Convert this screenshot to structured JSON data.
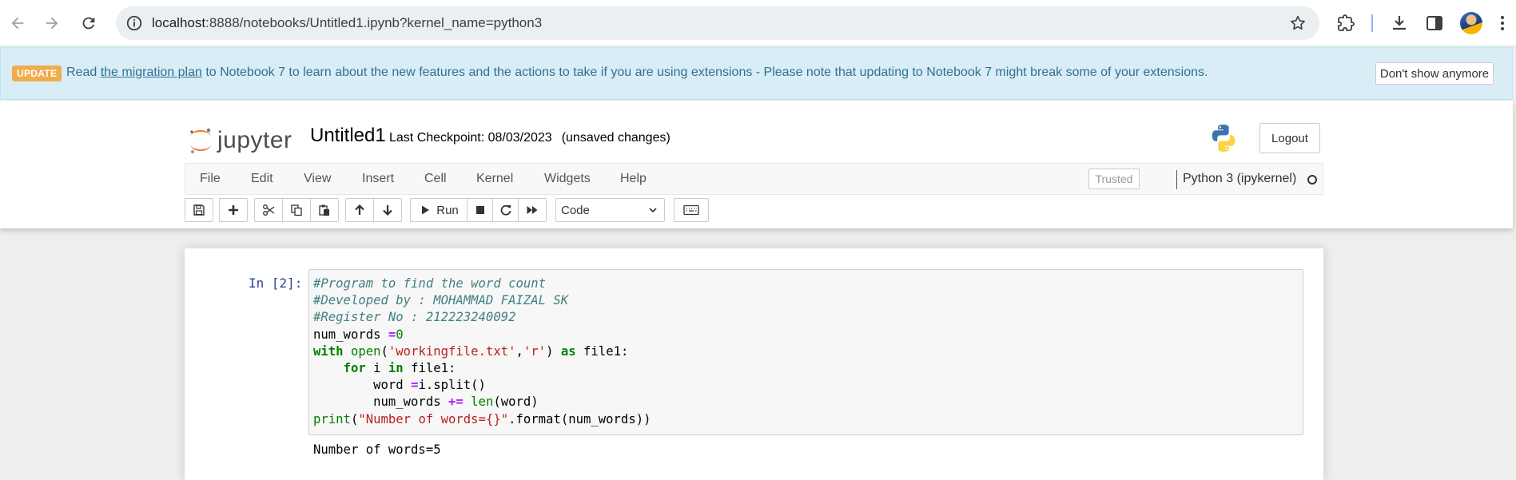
{
  "browser": {
    "url_host": "localhost",
    "url_rest": ":8888/notebooks/Untitled1.ipynb?kernel_name=python3"
  },
  "banner": {
    "badge": "UPDATE",
    "text_before": "Read ",
    "link": "the migration plan",
    "text_after": " to Notebook 7 to learn about the new features and the actions to take if you are using extensions - Please note that updating to Notebook 7 might break some of your extensions.",
    "dismiss": "Don't show anymore"
  },
  "header": {
    "logo_text": "jupyter",
    "notebook_name": "Untitled1",
    "checkpoint": "Last Checkpoint: 08/03/2023",
    "unsaved": "(unsaved changes)",
    "logout": "Logout"
  },
  "menu": {
    "items": [
      "File",
      "Edit",
      "View",
      "Insert",
      "Cell",
      "Kernel",
      "Widgets",
      "Help"
    ],
    "trusted": "Trusted",
    "kernel": "Python 3 (ipykernel)"
  },
  "toolbar": {
    "run_label": "Run",
    "cell_type": "Code"
  },
  "cell": {
    "prompt": "In [2]:",
    "code_lines": [
      "#Program to find the word count",
      "#Developed by : MOHAMMAD FAIZAL SK",
      "#Register No : 212223240092",
      "num_words =0",
      "with open('workingfile.txt','r') as file1:",
      "    for i in file1:",
      "        word =i.split()",
      "        num_words += len(word)",
      "print(\"Number of words={}\".format(num_words))"
    ],
    "output": "Number of words=5"
  },
  "colors": {
    "banner_bg": "#d9edf7",
    "banner_text": "#31708f",
    "badge": "#f0ad4e",
    "prompt": "#303f9f",
    "comment": "#408080",
    "keyword": "#008000",
    "string": "#ba2121"
  }
}
